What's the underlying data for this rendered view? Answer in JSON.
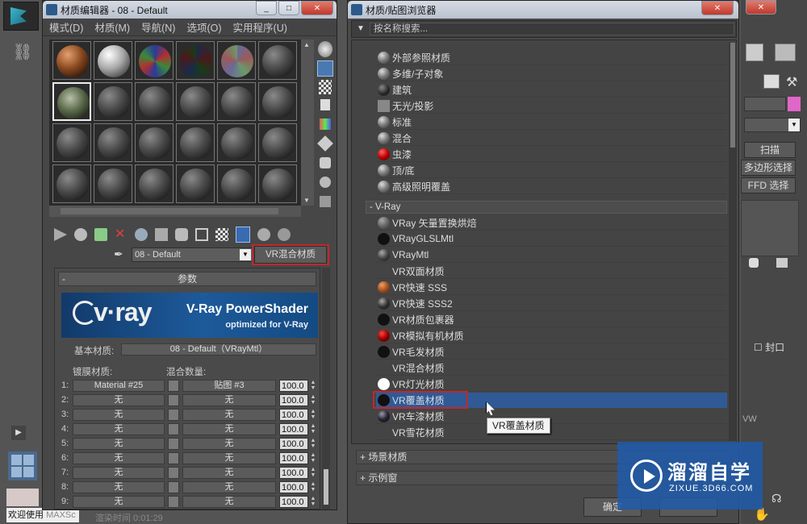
{
  "material_editor": {
    "title": "材质编辑器 - 08 - Default",
    "menu": [
      "模式(D)",
      "材质(M)",
      "导航(N)",
      "选项(O)",
      "实用程序(U)"
    ],
    "material_name": "08 - Default",
    "material_type_button": "VR混合材质",
    "rollout_title": "参数",
    "banner_brand": "v·ray",
    "banner_title": "V-Ray PowerShader",
    "banner_subtitle": "optimized for V-Ray",
    "base_material_label": "基本材质:",
    "base_material_value": "08 - Default（VRayMtl）",
    "coat_label": "镀膜材质:",
    "blend_label": "混合数量:",
    "rows": [
      {
        "n": "1:",
        "coat": "Material #25",
        "blend": "贴图 #3",
        "val": "100.0"
      },
      {
        "n": "2:",
        "coat": "无",
        "blend": "无",
        "val": "100.0"
      },
      {
        "n": "3:",
        "coat": "无",
        "blend": "无",
        "val": "100.0"
      },
      {
        "n": "4:",
        "coat": "无",
        "blend": "无",
        "val": "100.0"
      },
      {
        "n": "5:",
        "coat": "无",
        "blend": "无",
        "val": "100.0"
      },
      {
        "n": "6:",
        "coat": "无",
        "blend": "无",
        "val": "100.0"
      },
      {
        "n": "7:",
        "coat": "无",
        "blend": "无",
        "val": "100.0"
      },
      {
        "n": "8:",
        "coat": "无",
        "blend": "无",
        "val": "100.0"
      },
      {
        "n": "9:",
        "coat": "无",
        "blend": "无",
        "val": "100.0"
      }
    ],
    "status_left": "欢迎使用",
    "status_left2": "MAXSc",
    "render_time": "渲染时间  0:01:29"
  },
  "browser": {
    "title": "材质/贴图浏览器",
    "search_placeholder": "按名称搜索...",
    "std_items": [
      "外部参照材质",
      "多维/子对象",
      "建筑",
      "无光/投影",
      "标准",
      "混合",
      "虫漆",
      "顶/底",
      "高级照明覆盖"
    ],
    "vray_header": "- V-Ray",
    "vray_items": [
      "VRay 矢量置换烘焙",
      "VRayGLSLMtl",
      "VRayMtl",
      "VR双面材质",
      "VR快速 SSS",
      "VR快速 SSS2",
      "VR材质包裹器",
      "VR模拟有机材质",
      "VR毛发材质",
      "VR混合材质",
      "VR灯光材质",
      "VR覆盖材质",
      "VR车漆材质",
      "VR雪花材质"
    ],
    "selected_item": "VR覆盖材质",
    "tooltip": "VR覆盖材质",
    "scene_materials": "+ 场景材质",
    "sample_slots": "+ 示例窗",
    "ok_button": "确定"
  },
  "right_panel": {
    "scan": "扫描",
    "poly_select": "多边形选择",
    "ffd_select": "FFD 选择",
    "cap": "封口",
    "vw": "VW"
  },
  "watermark": {
    "name": "溜溜自学",
    "url": "ZIXUE.3D66.COM"
  },
  "colors": {
    "accent_red": "#c0282d",
    "selection_blue": "#2f5a96",
    "swatch_pink": "#e066c8"
  }
}
